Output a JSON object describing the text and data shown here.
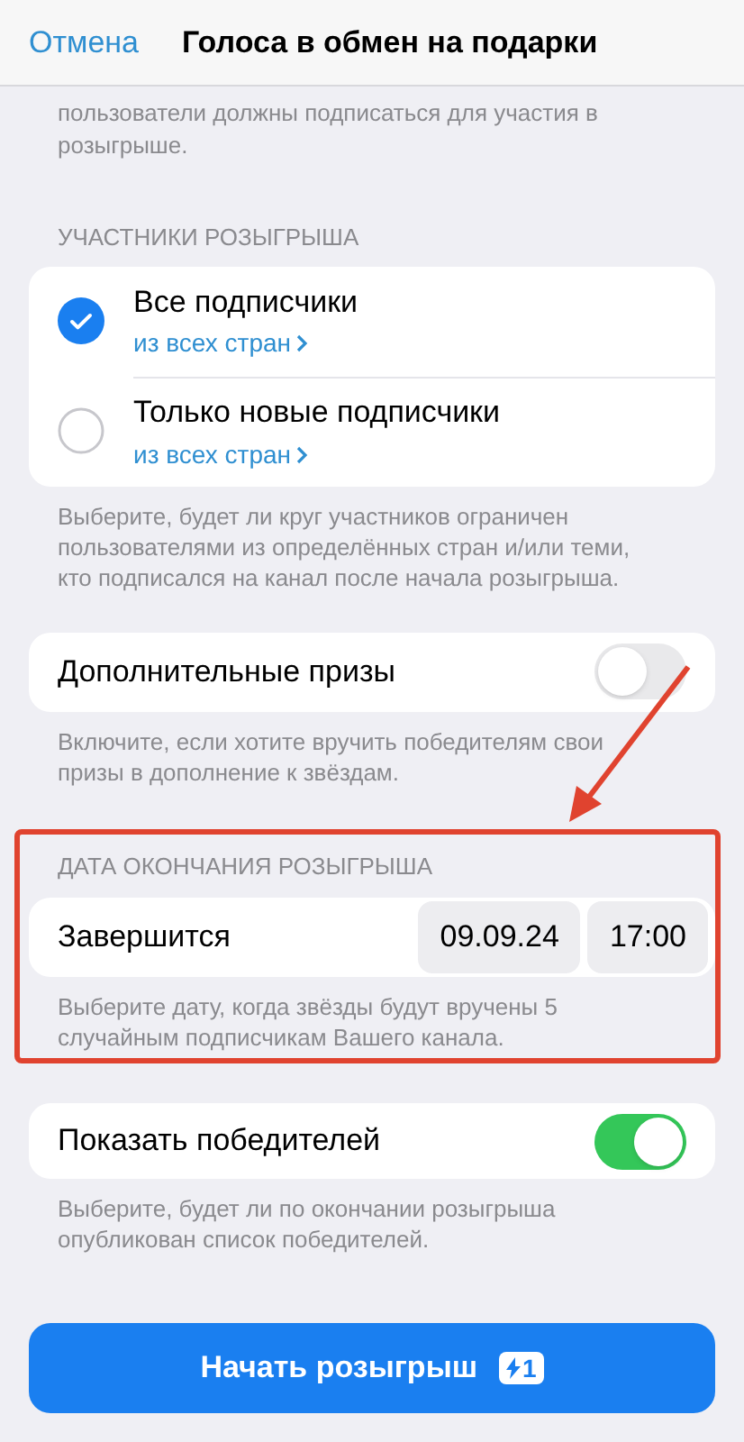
{
  "header": {
    "cancel": "Отмена",
    "title": "Голоса в обмен на подарки"
  },
  "intro_note": "пользователи должны подписаться для участия в розыгрыше.",
  "participants": {
    "heading": "УЧАСТНИКИ РОЗЫГРЫША",
    "options": [
      {
        "label": "Все подписчики",
        "link": "из всех стран",
        "selected": true
      },
      {
        "label": "Только новые подписчики",
        "link": "из всех стран",
        "selected": false
      }
    ],
    "note": "Выберите, будет ли круг участников ограничен пользователями из определённых стран и/или теми, кто подписался на канал после начала розыгрыша."
  },
  "extra_prizes": {
    "label": "Дополнительные призы",
    "on": false,
    "note": "Включите, если хотите вручить победителям свои призы в дополнение к звёздам."
  },
  "end_date": {
    "heading": "ДАТА ОКОНЧАНИЯ РОЗЫГРЫША",
    "label": "Завершится",
    "date": "09.09.24",
    "time": "17:00",
    "note": "Выберите дату, когда звёзды будут вручены 5 случайным подписчикам Вашего канала."
  },
  "show_winners": {
    "label": "Показать победителей",
    "on": true,
    "note": "Выберите, будет ли по окончании розыгрыша опубликован список победителей."
  },
  "start_button": {
    "label": "Начать розыгрыш",
    "badge": "1"
  }
}
